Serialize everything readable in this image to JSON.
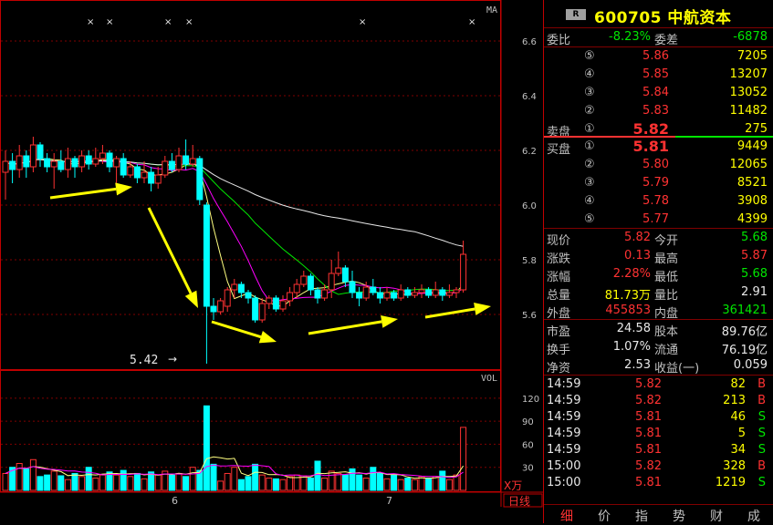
{
  "chart": {
    "ma_label": "MA",
    "vol_label": "VOL",
    "vol_unit": "X万",
    "period_label": "日线",
    "price_axis": [
      "6.6",
      "6.4",
      "6.2",
      "6.0",
      "5.8",
      "5.6"
    ],
    "vol_axis": [
      "120",
      "90",
      "60",
      "30"
    ],
    "date_labels": [
      "6",
      "7"
    ],
    "low_marker": "5.42",
    "x_markers": [
      "×",
      "×",
      "×",
      "×",
      "×",
      "×"
    ]
  },
  "chart_data": {
    "type": "candlestick",
    "price_ylim": [
      5.4,
      6.75
    ],
    "vol_ylim": [
      0,
      140
    ],
    "candles": [
      {
        "o": 6.12,
        "c": 6.16,
        "h": 6.2,
        "l": 6.02,
        "v": 22
      },
      {
        "o": 6.16,
        "c": 6.13,
        "h": 6.19,
        "l": 6.08,
        "v": 30
      },
      {
        "o": 6.13,
        "c": 6.18,
        "h": 6.22,
        "l": 6.1,
        "v": 35
      },
      {
        "o": 6.18,
        "c": 6.14,
        "h": 6.2,
        "l": 6.1,
        "v": 28
      },
      {
        "o": 6.14,
        "c": 6.22,
        "h": 6.25,
        "l": 6.12,
        "v": 40
      },
      {
        "o": 6.22,
        "c": 6.17,
        "h": 6.23,
        "l": 6.14,
        "v": 18
      },
      {
        "o": 6.17,
        "c": 6.14,
        "h": 6.19,
        "l": 6.12,
        "v": 20
      },
      {
        "o": 6.14,
        "c": 6.16,
        "h": 6.19,
        "l": 6.06,
        "v": 25
      },
      {
        "o": 6.16,
        "c": 6.13,
        "h": 6.2,
        "l": 6.12,
        "v": 19
      },
      {
        "o": 6.13,
        "c": 6.17,
        "h": 6.21,
        "l": 6.1,
        "v": 14
      },
      {
        "o": 6.17,
        "c": 6.14,
        "h": 6.18,
        "l": 6.1,
        "v": 22
      },
      {
        "o": 6.14,
        "c": 6.18,
        "h": 6.2,
        "l": 6.12,
        "v": 18
      },
      {
        "o": 6.18,
        "c": 6.15,
        "h": 6.2,
        "l": 6.13,
        "v": 30
      },
      {
        "o": 6.15,
        "c": 6.17,
        "h": 6.21,
        "l": 6.14,
        "v": 16
      },
      {
        "o": 6.17,
        "c": 6.19,
        "h": 6.22,
        "l": 6.15,
        "v": 20
      },
      {
        "o": 6.19,
        "c": 6.14,
        "h": 6.2,
        "l": 6.12,
        "v": 24
      },
      {
        "o": 6.14,
        "c": 6.17,
        "h": 6.18,
        "l": 6.08,
        "v": 20
      },
      {
        "o": 6.17,
        "c": 6.11,
        "h": 6.19,
        "l": 6.1,
        "v": 26
      },
      {
        "o": 6.11,
        "c": 6.14,
        "h": 6.16,
        "l": 6.1,
        "v": 18
      },
      {
        "o": 6.14,
        "c": 6.1,
        "h": 6.15,
        "l": 6.08,
        "v": 22
      },
      {
        "o": 6.1,
        "c": 6.12,
        "h": 6.16,
        "l": 6.08,
        "v": 15
      },
      {
        "o": 6.12,
        "c": 6.08,
        "h": 6.14,
        "l": 6.05,
        "v": 24
      },
      {
        "o": 6.08,
        "c": 6.11,
        "h": 6.14,
        "l": 6.06,
        "v": 20
      },
      {
        "o": 6.11,
        "c": 6.16,
        "h": 6.18,
        "l": 6.1,
        "v": 25
      },
      {
        "o": 6.16,
        "c": 6.13,
        "h": 6.19,
        "l": 6.12,
        "v": 20
      },
      {
        "o": 6.13,
        "c": 6.18,
        "h": 6.21,
        "l": 6.12,
        "v": 22
      },
      {
        "o": 6.18,
        "c": 6.15,
        "h": 6.24,
        "l": 6.13,
        "v": 18
      },
      {
        "o": 6.15,
        "c": 6.17,
        "h": 6.22,
        "l": 6.14,
        "v": 30
      },
      {
        "o": 6.17,
        "c": 6.02,
        "h": 6.18,
        "l": 6.0,
        "v": 26
      },
      {
        "o": 6.0,
        "c": 5.63,
        "h": 6.01,
        "l": 5.42,
        "v": 110
      },
      {
        "o": 5.63,
        "c": 5.61,
        "h": 5.66,
        "l": 5.58,
        "v": 34
      },
      {
        "o": 5.61,
        "c": 5.65,
        "h": 5.66,
        "l": 5.6,
        "v": 12
      },
      {
        "o": 5.63,
        "c": 5.69,
        "h": 5.7,
        "l": 5.61,
        "v": 22
      },
      {
        "o": 5.69,
        "c": 5.71,
        "h": 5.73,
        "l": 5.66,
        "v": 30
      },
      {
        "o": 5.71,
        "c": 5.68,
        "h": 5.72,
        "l": 5.66,
        "v": 14
      },
      {
        "o": 5.68,
        "c": 5.66,
        "h": 5.69,
        "l": 5.64,
        "v": 18
      },
      {
        "o": 5.66,
        "c": 5.58,
        "h": 5.67,
        "l": 5.57,
        "v": 34
      },
      {
        "o": 5.58,
        "c": 5.64,
        "h": 5.66,
        "l": 5.57,
        "v": 20
      },
      {
        "o": 5.64,
        "c": 5.66,
        "h": 5.67,
        "l": 5.62,
        "v": 16
      },
      {
        "o": 5.66,
        "c": 5.62,
        "h": 5.67,
        "l": 5.61,
        "v": 15
      },
      {
        "o": 5.62,
        "c": 5.65,
        "h": 5.67,
        "l": 5.61,
        "v": 14
      },
      {
        "o": 5.65,
        "c": 5.68,
        "h": 5.7,
        "l": 5.63,
        "v": 18
      },
      {
        "o": 5.68,
        "c": 5.71,
        "h": 5.73,
        "l": 5.66,
        "v": 20
      },
      {
        "o": 5.71,
        "c": 5.74,
        "h": 5.76,
        "l": 5.7,
        "v": 19
      },
      {
        "o": 5.74,
        "c": 5.69,
        "h": 5.75,
        "l": 5.67,
        "v": 16
      },
      {
        "o": 5.69,
        "c": 5.66,
        "h": 5.7,
        "l": 5.64,
        "v": 38
      },
      {
        "o": 5.66,
        "c": 5.69,
        "h": 5.71,
        "l": 5.65,
        "v": 16
      },
      {
        "o": 5.69,
        "c": 5.75,
        "h": 5.8,
        "l": 5.66,
        "v": 25
      },
      {
        "o": 5.75,
        "c": 5.77,
        "h": 5.83,
        "l": 5.74,
        "v": 22
      },
      {
        "o": 5.77,
        "c": 5.72,
        "h": 5.78,
        "l": 5.7,
        "v": 20
      },
      {
        "o": 5.72,
        "c": 5.68,
        "h": 5.76,
        "l": 5.66,
        "v": 28
      },
      {
        "o": 5.68,
        "c": 5.66,
        "h": 5.7,
        "l": 5.63,
        "v": 20
      },
      {
        "o": 5.66,
        "c": 5.7,
        "h": 5.72,
        "l": 5.65,
        "v": 16
      },
      {
        "o": 5.7,
        "c": 5.68,
        "h": 5.73,
        "l": 5.67,
        "v": 30
      },
      {
        "o": 5.68,
        "c": 5.66,
        "h": 5.7,
        "l": 5.64,
        "v": 22
      },
      {
        "o": 5.66,
        "c": 5.68,
        "h": 5.7,
        "l": 5.65,
        "v": 15
      },
      {
        "o": 5.68,
        "c": 5.66,
        "h": 5.69,
        "l": 5.65,
        "v": 20
      },
      {
        "o": 5.66,
        "c": 5.69,
        "h": 5.71,
        "l": 5.65,
        "v": 14
      },
      {
        "o": 5.69,
        "c": 5.67,
        "h": 5.7,
        "l": 5.66,
        "v": 16
      },
      {
        "o": 5.67,
        "c": 5.68,
        "h": 5.7,
        "l": 5.66,
        "v": 14
      },
      {
        "o": 5.68,
        "c": 5.69,
        "h": 5.71,
        "l": 5.66,
        "v": 18
      },
      {
        "o": 5.69,
        "c": 5.67,
        "h": 5.7,
        "l": 5.66,
        "v": 16
      },
      {
        "o": 5.67,
        "c": 5.69,
        "h": 5.72,
        "l": 5.66,
        "v": 18
      },
      {
        "o": 5.69,
        "c": 5.67,
        "h": 5.7,
        "l": 5.65,
        "v": 25
      },
      {
        "o": 5.67,
        "c": 5.68,
        "h": 5.71,
        "l": 5.66,
        "v": 14
      },
      {
        "o": 5.68,
        "c": 5.69,
        "h": 5.7,
        "l": 5.66,
        "v": 20
      },
      {
        "o": 5.69,
        "c": 5.82,
        "h": 5.87,
        "l": 5.68,
        "v": 82
      }
    ],
    "ma_series": [
      {
        "color": "#ffff80"
      },
      {
        "color": "#ff00ff"
      },
      {
        "color": "#00e600"
      },
      {
        "color": "#e8e8e8"
      }
    ]
  },
  "quote": {
    "code": "600705",
    "name": "中航资本",
    "badge": "R",
    "weibi_label": "委比",
    "weibi": "-8.23%",
    "weicha_label": "委差",
    "weicha": "-6878",
    "sell_label": "卖盘",
    "buy_label": "买盘",
    "asks": [
      {
        "level": "⑤",
        "price": "5.86",
        "vol": "7205"
      },
      {
        "level": "④",
        "price": "5.85",
        "vol": "13207"
      },
      {
        "level": "③",
        "price": "5.84",
        "vol": "13052"
      },
      {
        "level": "②",
        "price": "5.83",
        "vol": "11482"
      },
      {
        "level": "①",
        "price": "5.82",
        "vol": "275"
      }
    ],
    "bids": [
      {
        "level": "①",
        "price": "5.81",
        "vol": "9449"
      },
      {
        "level": "②",
        "price": "5.80",
        "vol": "12065"
      },
      {
        "level": "③",
        "price": "5.79",
        "vol": "8521"
      },
      {
        "level": "④",
        "price": "5.78",
        "vol": "3908"
      },
      {
        "level": "⑤",
        "price": "5.77",
        "vol": "4399"
      }
    ],
    "stats": [
      {
        "l1": "现价",
        "v1": "5.82",
        "c1": "red",
        "l2": "今开",
        "v2": "5.68",
        "c2": "grn"
      },
      {
        "l1": "涨跌",
        "v1": "0.13",
        "c1": "red",
        "l2": "最高",
        "v2": "5.87",
        "c2": "red"
      },
      {
        "l1": "涨幅",
        "v1": "2.28%",
        "c1": "red",
        "l2": "最低",
        "v2": "5.68",
        "c2": "grn"
      },
      {
        "l1": "总量",
        "v1": "81.73万",
        "c1": "yel",
        "l2": "量比",
        "v2": "2.91",
        "c2": "wht"
      },
      {
        "l1": "外盘",
        "v1": "455853",
        "c1": "red",
        "l2": "内盘",
        "v2": "361421",
        "c2": "grn"
      }
    ],
    "fund": [
      {
        "l1": "市盈",
        "v1": "24.58",
        "l2": "股本",
        "v2": "89.76亿"
      },
      {
        "l1": "换手",
        "v1": "1.07%",
        "l2": "流通",
        "v2": "76.19亿"
      },
      {
        "l1": "净资",
        "v1": "2.53",
        "l2": "收益(一)",
        "v2": "0.059"
      }
    ],
    "ticks": [
      {
        "time": "14:59",
        "price": "5.82",
        "pc": "red",
        "vol": "82",
        "side": "B",
        "sc": "red"
      },
      {
        "time": "14:59",
        "price": "5.82",
        "pc": "red",
        "vol": "213",
        "side": "B",
        "sc": "red"
      },
      {
        "time": "14:59",
        "price": "5.81",
        "pc": "red",
        "vol": "46",
        "side": "S",
        "sc": "grn"
      },
      {
        "time": "14:59",
        "price": "5.81",
        "pc": "red",
        "vol": "5",
        "side": "S",
        "sc": "grn"
      },
      {
        "time": "14:59",
        "price": "5.81",
        "pc": "red",
        "vol": "34",
        "side": "S",
        "sc": "grn"
      },
      {
        "time": "15:00",
        "price": "5.82",
        "pc": "red",
        "vol": "328",
        "side": "B",
        "sc": "red"
      },
      {
        "time": "15:00",
        "price": "5.81",
        "pc": "red",
        "vol": "1219",
        "side": "S",
        "sc": "grn"
      }
    ],
    "tabs": [
      "细",
      "价",
      "指",
      "势",
      "财",
      "成"
    ]
  },
  "colors": {
    "up": "#ff3232",
    "down": "#00ffff",
    "frame": "#c00000",
    "arrow": "#ffff00"
  }
}
